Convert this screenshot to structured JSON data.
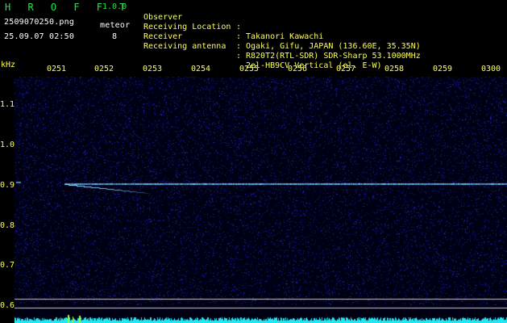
{
  "header": {
    "app_title": "H R O F F T",
    "app_version": "1.0.0",
    "filename": "2509070250.png",
    "datetime": "25.09.07 02:50",
    "meteor_label": "meteor",
    "meteor_count": "8"
  },
  "info": [
    {
      "label": "Observer",
      "sep": ":",
      "value": "Takanori Kawachi"
    },
    {
      "label": "Receiving Location",
      "sep": ":",
      "value": "Ogaki, Gifu, JAPAN (136.60E, 35.35N)"
    },
    {
      "label": "Receiver",
      "sep": ":",
      "value": "R820T2(RTL-SDR) SDR-Sharp 53.1000MHz"
    },
    {
      "label": "Receiving antenna",
      "sep": ":",
      "value": "2el-HB9CV Vertical (el. E-W)"
    }
  ],
  "axis": {
    "freq_unit": "kHz",
    "time_ticks": [
      "0251",
      "0252",
      "0253",
      "0254",
      "0255",
      "0256",
      "0257",
      "0258",
      "0259",
      "0300"
    ],
    "freq_ticks": [
      "1.1",
      "1.0",
      "0.9",
      "0.8",
      "0.7",
      "0.6"
    ]
  },
  "colors": {
    "background": "#000000",
    "title_green": "#23e34d",
    "axis_yellow": "#ffff55",
    "noise_blue": "#1a2a9a",
    "signal_cyan": "#66ccff",
    "baseline_cyan": "#22e6f0"
  }
}
